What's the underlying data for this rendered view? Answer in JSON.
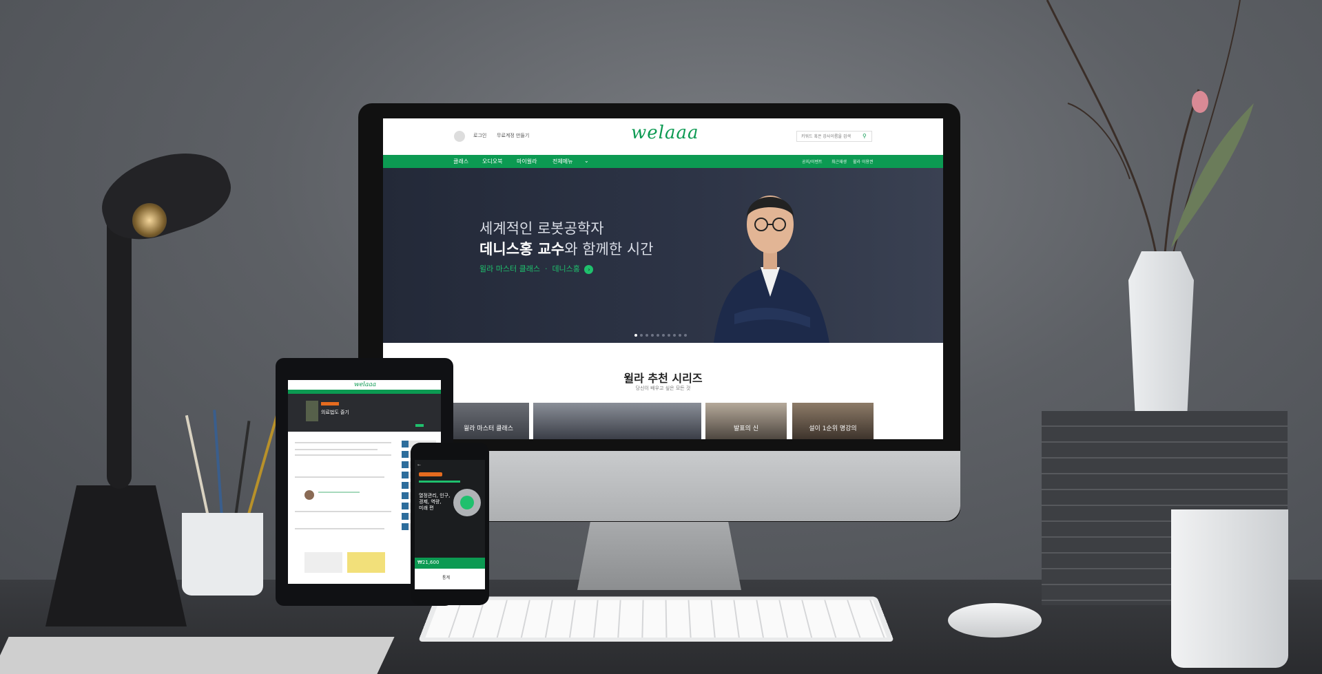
{
  "site": {
    "logo": "welaaa",
    "header": {
      "login": "로그인",
      "signup": "무료계정 만들기",
      "search_placeholder": "키워드 혹은 강사이름을 검색"
    },
    "nav": [
      "클래스",
      "오디오북",
      "마이윌라",
      "전체메뉴"
    ],
    "nav_right": [
      "공지/이벤트",
      "최근재생",
      "윌라 이용권"
    ]
  },
  "hero": {
    "line1": "세계적인 로봇공학자",
    "line2_bold": "데니스홍 교수",
    "line2_rest": "와 함께한 시간",
    "tag_series": "윌라 마스터 클래스",
    "tag_name": "데니스홍",
    "slide_count": 10,
    "active_slide": 0
  },
  "recommend": {
    "title": "윌라 추천 시리즈",
    "subtitle": "당신이 배우고 싶은 모든 것",
    "cards": [
      "윌라 마스터 클래스",
      "",
      "발표의 신",
      "설이 1순위 명강의"
    ]
  },
  "tablet": {
    "logo": "welaaa",
    "hero_title": "의료법도 즐기"
  },
  "phone": {
    "text_lines": [
      "열정관리, 인구,",
      "경제, 역량,",
      "미래 편"
    ],
    "price": "₩21,600",
    "bottom_tab": "통계"
  },
  "colors": {
    "brand_green": "#0c9a52",
    "hero_bg": "#2a3040",
    "accent_green": "#1fc06d"
  }
}
